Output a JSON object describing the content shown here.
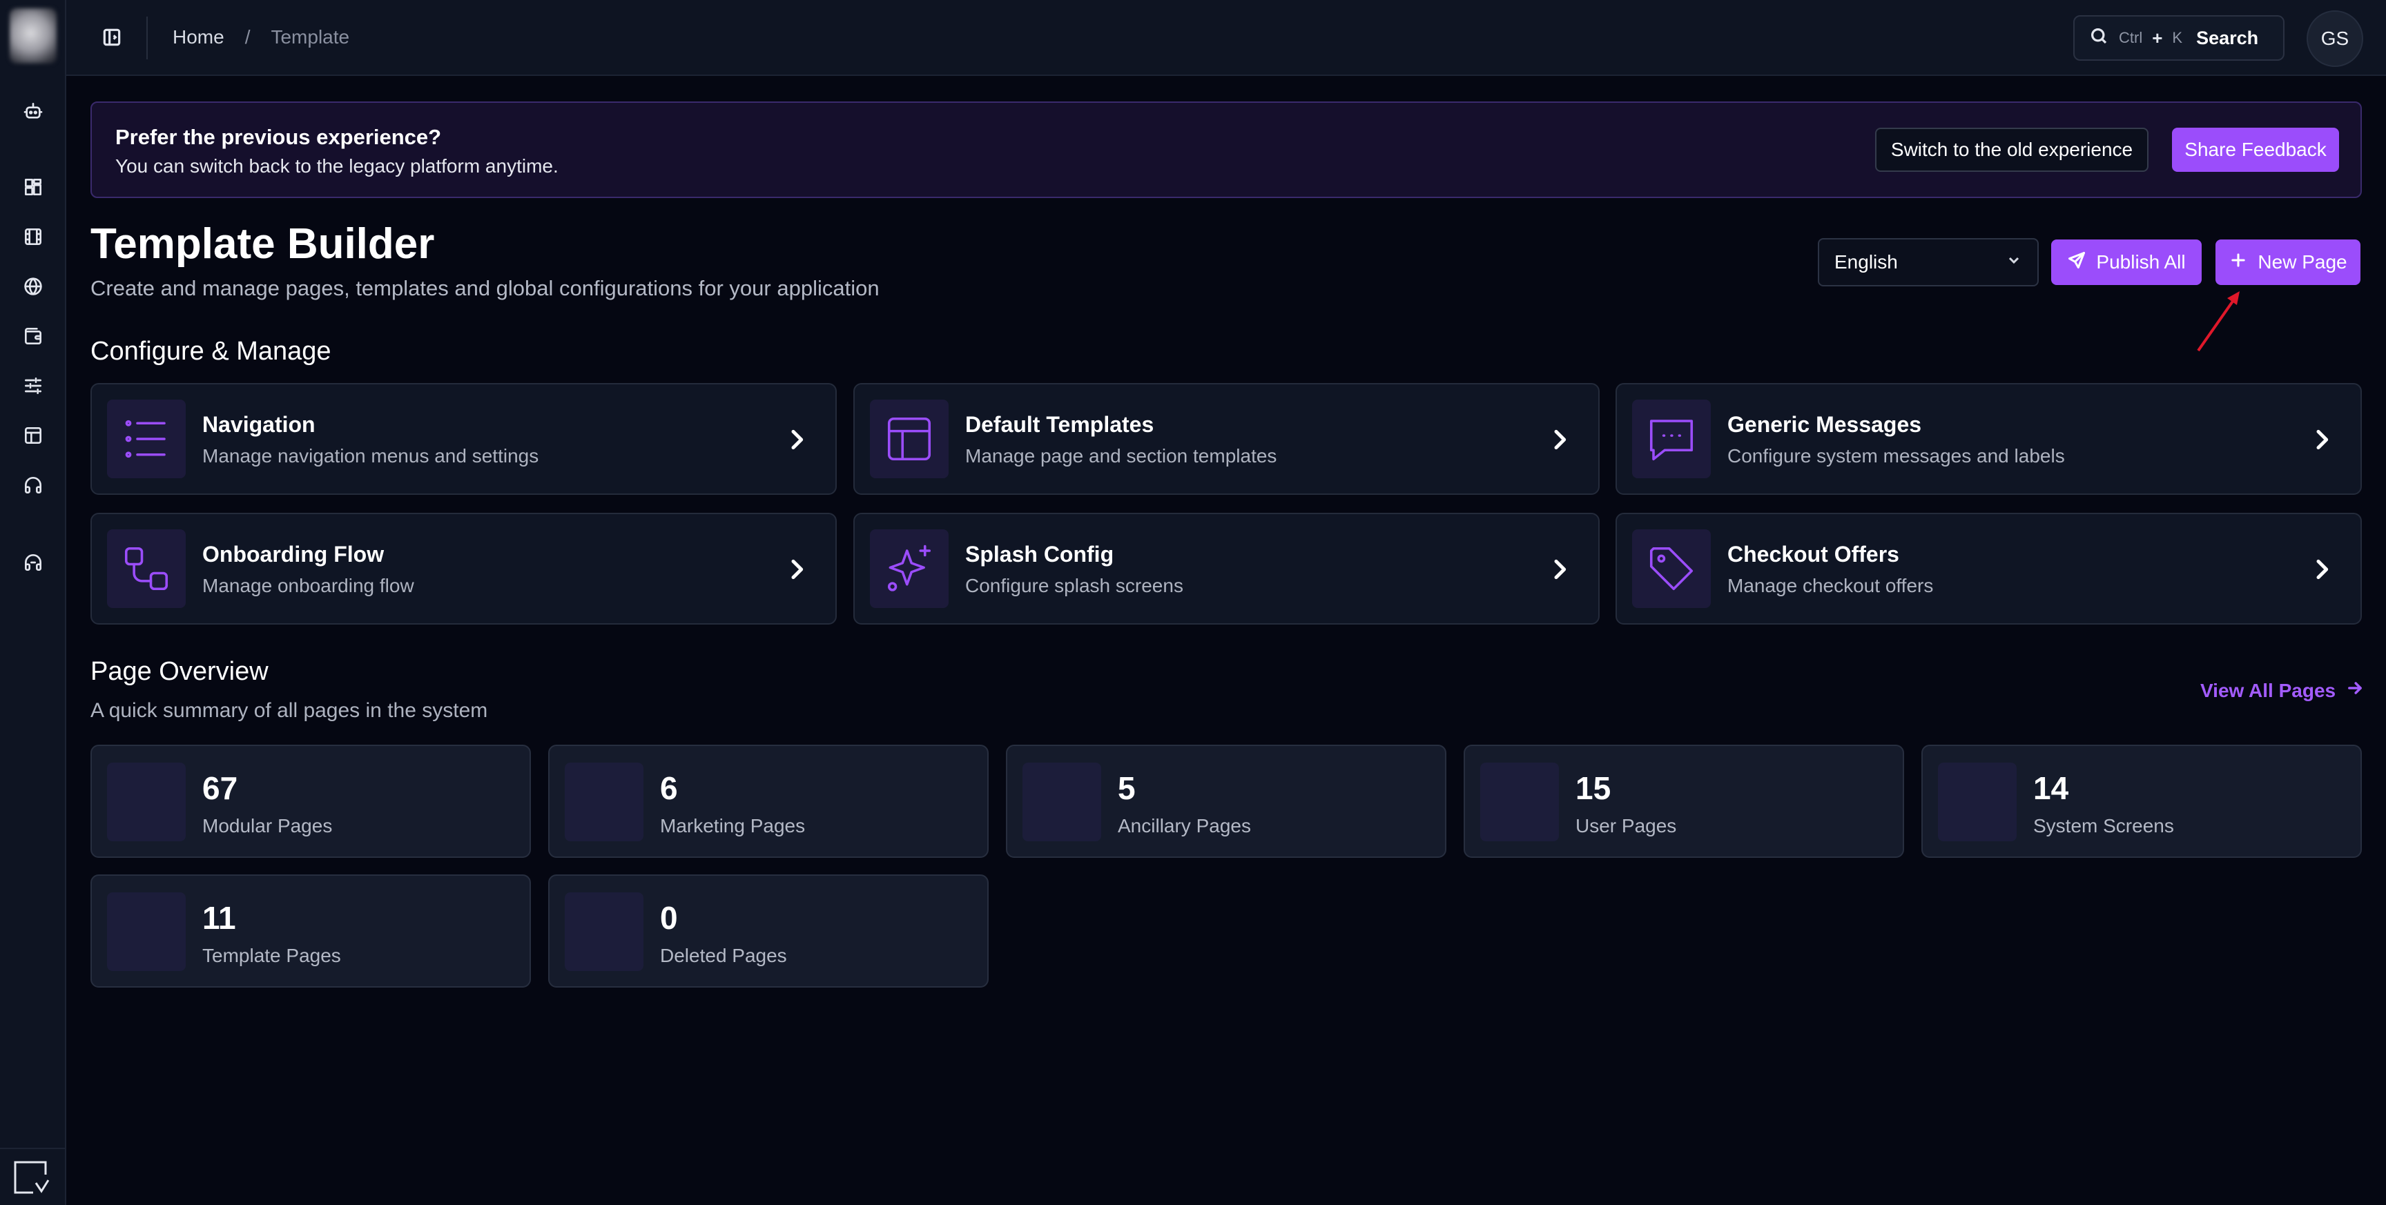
{
  "breadcrumb": {
    "home": "Home",
    "separator": "/",
    "current": "Template"
  },
  "search": {
    "ctrl": "Ctrl",
    "plus": "+",
    "k": "K",
    "label": "Search"
  },
  "user": {
    "initials": "GS"
  },
  "banner": {
    "title": "Prefer the previous experience?",
    "subtitle": "You can switch back to the legacy platform anytime.",
    "switch_label": "Switch to the old experience",
    "feedback_label": "Share Feedback"
  },
  "header": {
    "title": "Template Builder",
    "subtitle": "Create and manage pages, templates and global configurations for your application",
    "language": "English",
    "publish_label": "Publish All",
    "new_page_label": "New Page"
  },
  "configure": {
    "title": "Configure & Manage",
    "cards": [
      {
        "name": "Navigation",
        "desc": "Manage navigation menus and settings",
        "icon": "list-icon"
      },
      {
        "name": "Default Templates",
        "desc": "Manage page and section templates",
        "icon": "layout-icon"
      },
      {
        "name": "Generic Messages",
        "desc": "Configure system messages and labels",
        "icon": "message-icon"
      },
      {
        "name": "Onboarding Flow",
        "desc": "Manage onboarding flow",
        "icon": "flow-icon"
      },
      {
        "name": "Splash Config",
        "desc": "Configure splash screens",
        "icon": "sparkles-icon"
      },
      {
        "name": "Checkout Offers",
        "desc": "Manage checkout offers",
        "icon": "tag-icon"
      }
    ]
  },
  "overview": {
    "title": "Page Overview",
    "subtitle": "A quick summary of all pages in the system",
    "view_all": "View All Pages",
    "stats": [
      {
        "value": "67",
        "label": "Modular Pages"
      },
      {
        "value": "6",
        "label": "Marketing Pages"
      },
      {
        "value": "5",
        "label": "Ancillary Pages"
      },
      {
        "value": "15",
        "label": "User Pages"
      },
      {
        "value": "14",
        "label": "System Screens"
      },
      {
        "value": "11",
        "label": "Template Pages"
      },
      {
        "value": "0",
        "label": "Deleted Pages"
      }
    ]
  },
  "colors": {
    "accent": "#9b4dfb",
    "background": "#050712",
    "card": "#0f1524",
    "annotation": "#e0182a"
  }
}
